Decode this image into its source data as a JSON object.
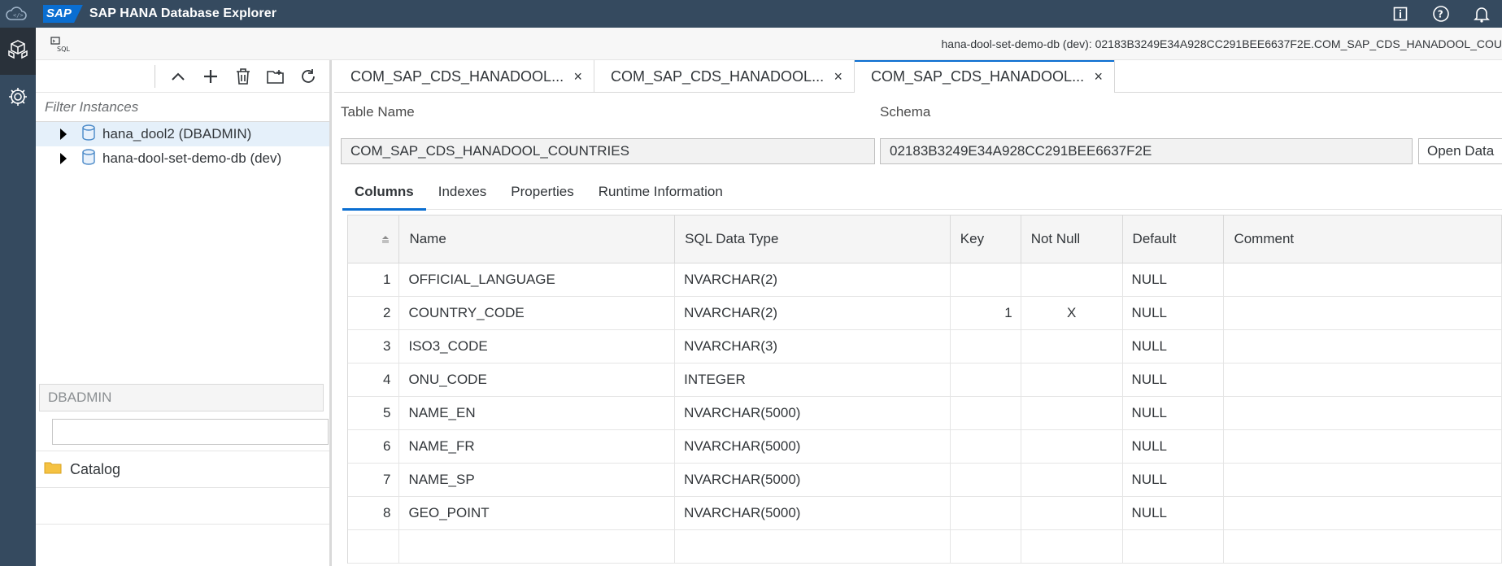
{
  "shell": {
    "app_title": "SAP HANA Database Explorer",
    "logo_text": "SAP",
    "icons": [
      "cloud-code-icon",
      "info-icon",
      "help-icon",
      "notifications-icon"
    ]
  },
  "toolbar": {
    "sql_label": "SQL",
    "breadcrumb": "hana-dool-set-demo-db (dev): 02183B3249E34A928CC291BEE6637F2E.COM_SAP_CDS_HANADOOL_COU"
  },
  "left_panel": {
    "filter_placeholder": "Filter Instances",
    "instances": [
      {
        "label": "hana_dool2 (DBADMIN)",
        "selected": true
      },
      {
        "label": "hana-dool-set-demo-db (dev)",
        "selected": false
      }
    ],
    "schema_value": "DBADMIN",
    "search_value": "",
    "catalog_label": "Catalog"
  },
  "tabs": [
    {
      "label": "COM_SAP_CDS_HANADOOL...",
      "close": "×"
    },
    {
      "label": "COM_SAP_CDS_HANADOOL...",
      "close": "×"
    },
    {
      "label": "COM_SAP_CDS_HANADOOL...",
      "close": "×"
    }
  ],
  "details": {
    "table_name_label": "Table Name",
    "table_name_value": "COM_SAP_CDS_HANADOOL_COUNTRIES",
    "schema_label": "Schema",
    "schema_value": "02183B3249E34A928CC291BEE6637F2E",
    "open_data_label": "Open Data"
  },
  "subtabs": [
    "Columns",
    "Indexes",
    "Properties",
    "Runtime Information"
  ],
  "columns_table": {
    "headers": [
      "",
      "Name",
      "SQL Data Type",
      "Key",
      "Not Null",
      "Default",
      "Comment"
    ],
    "rows": [
      {
        "num": "1",
        "name": "OFFICIAL_LANGUAGE",
        "type": "NVARCHAR(2)",
        "key": "",
        "not_null": "",
        "default": "NULL",
        "comment": ""
      },
      {
        "num": "2",
        "name": "COUNTRY_CODE",
        "type": "NVARCHAR(2)",
        "key": "1",
        "not_null": "X",
        "default": "NULL",
        "comment": ""
      },
      {
        "num": "3",
        "name": "ISO3_CODE",
        "type": "NVARCHAR(3)",
        "key": "",
        "not_null": "",
        "default": "NULL",
        "comment": ""
      },
      {
        "num": "4",
        "name": "ONU_CODE",
        "type": "INTEGER",
        "key": "",
        "not_null": "",
        "default": "NULL",
        "comment": ""
      },
      {
        "num": "5",
        "name": "NAME_EN",
        "type": "NVARCHAR(5000)",
        "key": "",
        "not_null": "",
        "default": "NULL",
        "comment": ""
      },
      {
        "num": "6",
        "name": "NAME_FR",
        "type": "NVARCHAR(5000)",
        "key": "",
        "not_null": "",
        "default": "NULL",
        "comment": ""
      },
      {
        "num": "7",
        "name": "NAME_SP",
        "type": "NVARCHAR(5000)",
        "key": "",
        "not_null": "",
        "default": "NULL",
        "comment": ""
      },
      {
        "num": "8",
        "name": "GEO_POINT",
        "type": "NVARCHAR(5000)",
        "key": "",
        "not_null": "",
        "default": "NULL",
        "comment": ""
      }
    ]
  },
  "colors": {
    "shell_bg": "#354a5f",
    "accent": "#0a6ed1",
    "selected_row": "#e5f0fa"
  }
}
